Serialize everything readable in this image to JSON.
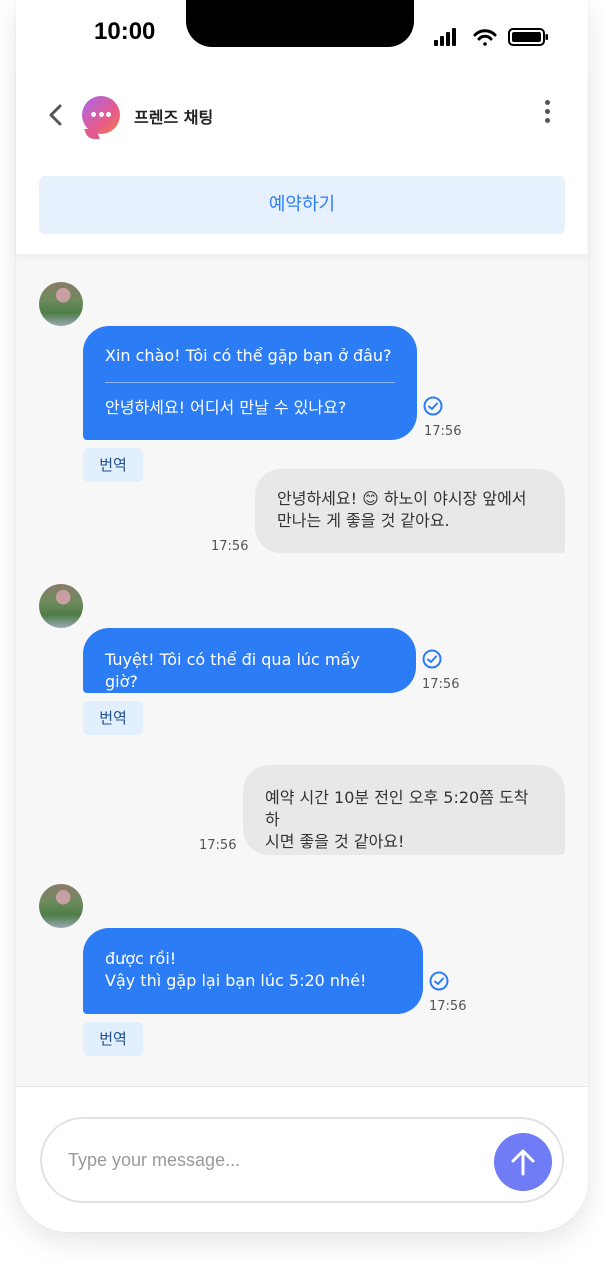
{
  "status_bar": {
    "time": "10:00"
  },
  "header": {
    "title": "프렌즈 채팅",
    "reserve_label": "예약하기"
  },
  "messages": [
    {
      "direction": "incoming",
      "lines": [
        "Xin chào! Tôi có thể gặp bạn ở đâu?"
      ],
      "translation": "안녕하세요! 어디서 만날 수 있나요?",
      "time": "17:56",
      "translate_label": "번역"
    },
    {
      "direction": "outgoing",
      "lines": [
        "안녕하세요! 😊 하노이 야시장 앞에서",
        "만나는 게 좋을 것 같아요."
      ],
      "time": "17:56"
    },
    {
      "direction": "incoming",
      "lines": [
        "Tuyệt! Tôi có thể đi qua lúc mấy giờ?"
      ],
      "time": "17:56",
      "translate_label": "번역"
    },
    {
      "direction": "outgoing",
      "lines": [
        "예약 시간 10분 전인 오후 5:20쯤 도착하",
        "시면 좋을 것 같아요!"
      ],
      "time": "17:56"
    },
    {
      "direction": "incoming",
      "lines": [
        "được rồi!",
        "Vậy thì gặp lại bạn lúc 5:20 nhé!"
      ],
      "time": "17:56",
      "translate_label": "번역"
    }
  ],
  "composer": {
    "placeholder": "Type your message..."
  },
  "colors": {
    "accent": "#2c7cf6",
    "send": "#6f7cf6",
    "translate_bg": "#e2effd"
  },
  "icons": {
    "back": "chevron-left-icon",
    "more": "more-vertical-icon",
    "read": "check-circle-icon",
    "send": "arrow-up-icon"
  }
}
